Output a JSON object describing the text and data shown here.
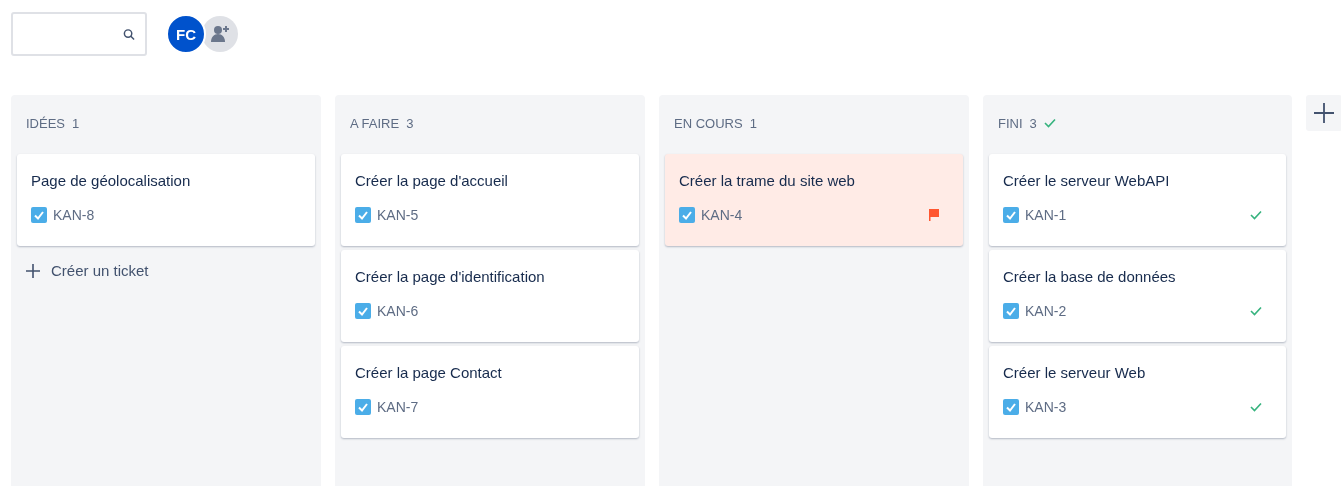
{
  "avatars": [
    {
      "initials": "FC"
    }
  ],
  "columns": [
    {
      "title": "IDÉES",
      "count": "1",
      "done": false,
      "create_label": "Créer un ticket",
      "cards": [
        {
          "title": "Page de géolocalisation",
          "key": "KAN-8",
          "flagged": false,
          "done": false
        }
      ]
    },
    {
      "title": "A FAIRE",
      "count": "3",
      "done": false,
      "cards": [
        {
          "title": "Créer la page d'accueil",
          "key": "KAN-5",
          "flagged": false,
          "done": false
        },
        {
          "title": "Créer la page d'identification",
          "key": "KAN-6",
          "flagged": false,
          "done": false
        },
        {
          "title": "Créer la page Contact",
          "key": "KAN-7",
          "flagged": false,
          "done": false
        }
      ]
    },
    {
      "title": "EN COURS",
      "count": "1",
      "done": false,
      "cards": [
        {
          "title": "Créer la trame du site web",
          "key": "KAN-4",
          "flagged": true,
          "done": false
        }
      ]
    },
    {
      "title": "FINI",
      "count": "3",
      "done": true,
      "cards": [
        {
          "title": "Créer le serveur WebAPI",
          "key": "KAN-1",
          "flagged": false,
          "done": true
        },
        {
          "title": "Créer la base de données",
          "key": "KAN-2",
          "flagged": false,
          "done": true
        },
        {
          "title": "Créer le serveur Web",
          "key": "KAN-3",
          "flagged": false,
          "done": true
        }
      ]
    }
  ]
}
